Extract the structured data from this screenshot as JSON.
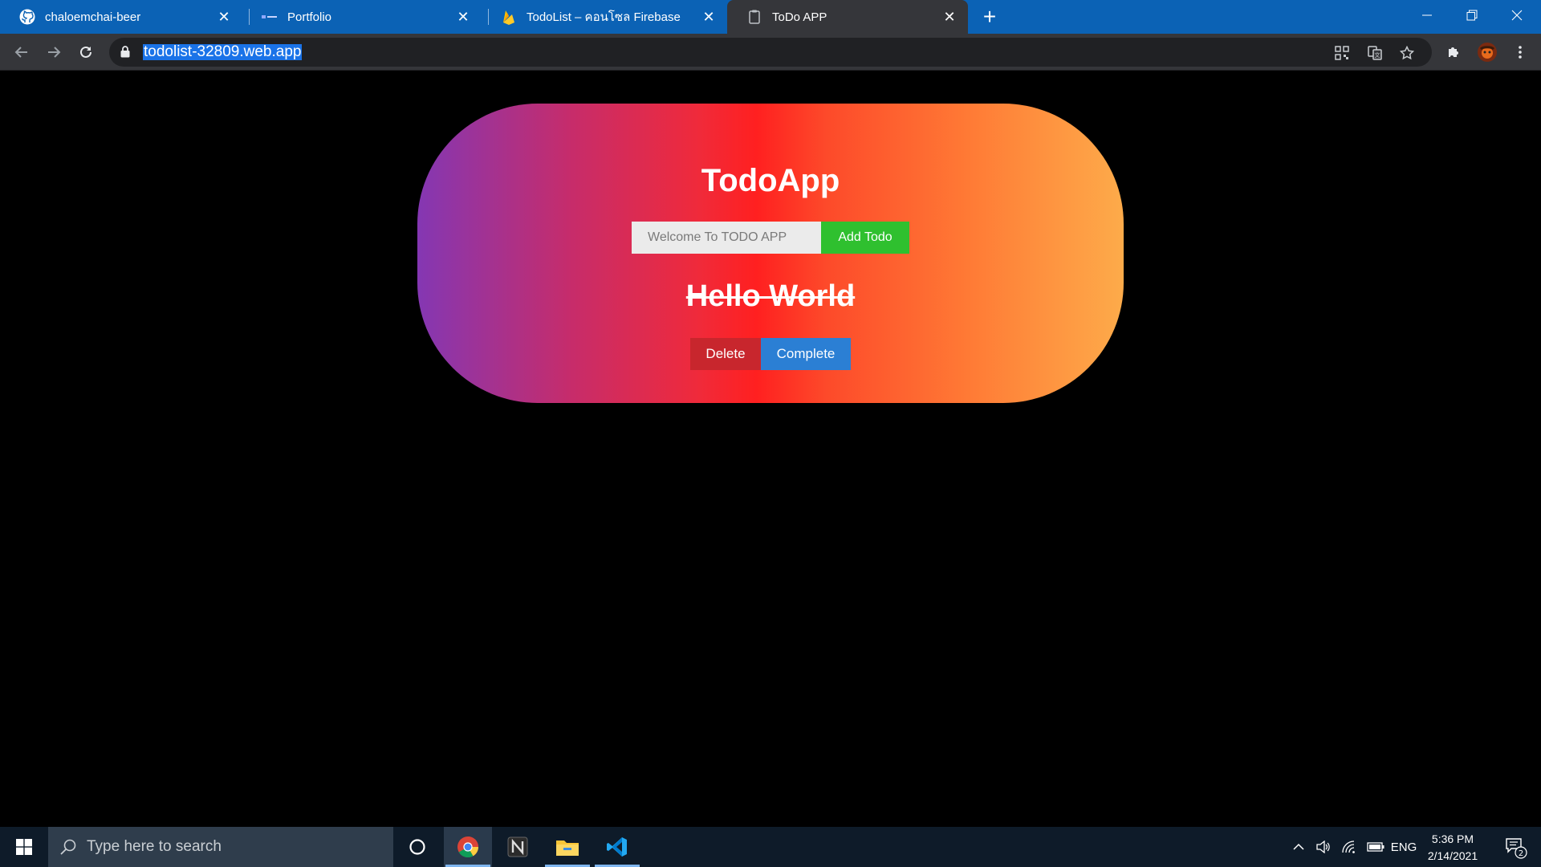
{
  "browser": {
    "tabs": [
      {
        "title": "chaloemchai-beer",
        "icon": "github-icon",
        "active": false
      },
      {
        "title": "Portfolio",
        "icon": "portfolio-icon",
        "active": false
      },
      {
        "title": "TodoList – คอนโซล Firebase",
        "icon": "firebase-icon",
        "active": false
      },
      {
        "title": "ToDo APP",
        "icon": "page-icon",
        "active": true
      }
    ],
    "new_tab_label": "+",
    "url": "todolist-32809.web.app",
    "colors": {
      "tabstrip": "#0b62b5",
      "toolbar": "#35363a",
      "omnibox": "#202124"
    }
  },
  "app": {
    "title": "TodoApp",
    "input_placeholder": "Welcome To TODO APP",
    "add_label": "Add Todo",
    "todos": [
      {
        "text": "Hello World",
        "completed": true,
        "delete_label": "Delete",
        "complete_label": "Complete"
      }
    ],
    "colors": {
      "gradient": [
        "#8437b3",
        "#ff2020",
        "#fdab4a"
      ],
      "add_button": "#2fc02f",
      "delete_button": "#c8262d",
      "complete_button": "#2b7fd4"
    }
  },
  "taskbar": {
    "search_placeholder": "Type here to search",
    "pinned_apps": [
      {
        "name": "cortana-icon"
      },
      {
        "name": "chrome-icon",
        "active": true
      },
      {
        "name": "notion-icon"
      },
      {
        "name": "file-explorer-icon"
      },
      {
        "name": "vscode-icon"
      }
    ],
    "language": "ENG",
    "time": "5:36 PM",
    "date": "2/14/2021",
    "notification_count": "2"
  }
}
